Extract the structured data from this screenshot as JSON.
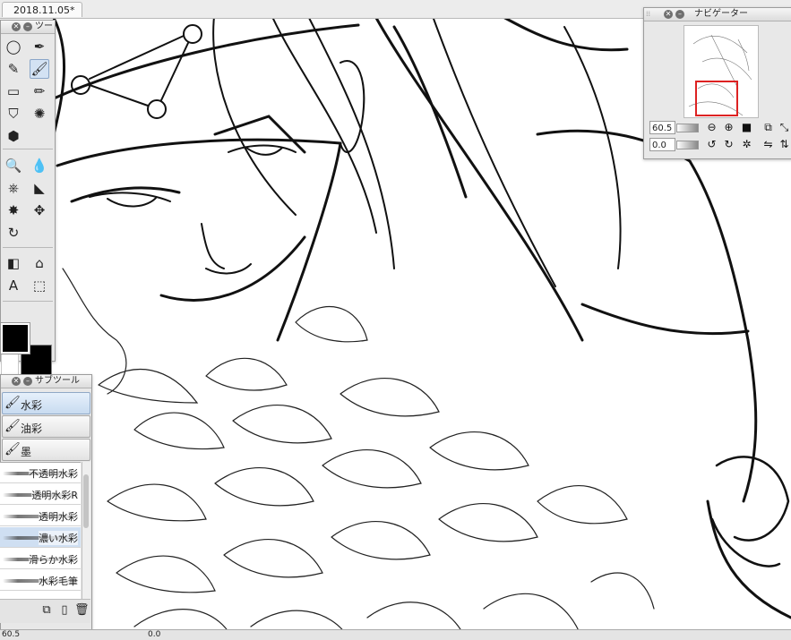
{
  "document": {
    "tab_title": "2018.11.05*"
  },
  "tool_palette": {
    "title": "ツー",
    "tools": [
      {
        "name": "lasso-tool",
        "glyph": "◯"
      },
      {
        "name": "eyedropper-tool",
        "glyph": "✒"
      },
      {
        "name": "pen-tool",
        "glyph": "✎"
      },
      {
        "name": "brush-tool",
        "glyph": "🖌"
      },
      {
        "name": "eraser-tool",
        "glyph": "▭"
      },
      {
        "name": "marker-tool",
        "glyph": "✏"
      },
      {
        "name": "fill-tool",
        "glyph": "⛉"
      },
      {
        "name": "blend-tool",
        "glyph": "✺"
      },
      {
        "name": "bucket-tool",
        "glyph": "⬢"
      },
      {
        "name": "zoom-tool",
        "glyph": "🔍"
      },
      {
        "name": "blur-tool",
        "glyph": "💧"
      },
      {
        "name": "stamp-tool",
        "glyph": "⎈"
      },
      {
        "name": "figure-tool",
        "glyph": "◣"
      },
      {
        "name": "sparkle-tool",
        "glyph": "✸"
      },
      {
        "name": "move-tool",
        "glyph": "✥"
      },
      {
        "name": "rotate-tool",
        "glyph": "↻"
      },
      {
        "name": "gradient-tool",
        "glyph": "◧"
      },
      {
        "name": "house-tool",
        "glyph": "⌂"
      },
      {
        "name": "text-tool",
        "glyph": "A"
      },
      {
        "name": "3d-tool",
        "glyph": "⬚"
      }
    ]
  },
  "sub_tool": {
    "title": "サブツール",
    "tabs": [
      {
        "label": "水彩",
        "icon": "watercolor-brush-icon",
        "active": true
      },
      {
        "label": "油彩",
        "icon": "oil-brush-icon",
        "active": false
      },
      {
        "label": "墨",
        "icon": "ink-brush-icon",
        "active": false
      }
    ],
    "brushes": [
      {
        "label": "不透明水彩",
        "selected": false
      },
      {
        "label": "透明水彩R",
        "selected": false
      },
      {
        "label": "透明水彩",
        "selected": false
      },
      {
        "label": "濃い水彩",
        "selected": true
      },
      {
        "label": "滑らか水彩",
        "selected": false
      },
      {
        "label": "水彩毛筆",
        "selected": false
      }
    ]
  },
  "navigator": {
    "title": "ナビゲーター",
    "zoom_value": "60.5",
    "rotation_value": "0.0"
  },
  "status": {
    "zoom": "60.5",
    "angle": "0.0"
  },
  "colors": {
    "main": "#000000",
    "sub": "#000000",
    "accent_selection": "#cfdff2",
    "nav_frame": "#dd2222"
  }
}
